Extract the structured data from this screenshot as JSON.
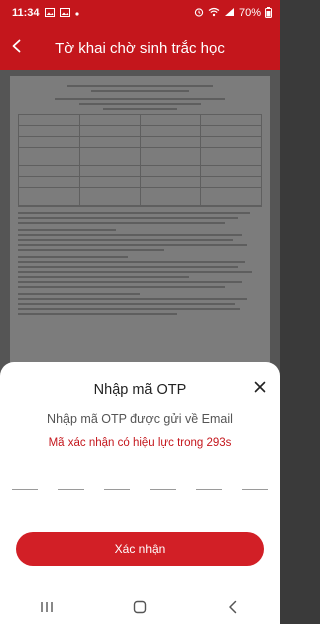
{
  "status_bar": {
    "time": "11:34",
    "battery": "70%",
    "left_icons": [
      "image-icon",
      "image-icon",
      "dot-icon"
    ],
    "right_icons": [
      "alarm-icon",
      "wifi-icon",
      "signal-icon",
      "battery-icon"
    ]
  },
  "header": {
    "title": "Tờ khai chờ sinh trắc học",
    "back_icon": "arrow-left-icon",
    "color": "#c4161c"
  },
  "otp_sheet": {
    "title": "Nhập mã OTP",
    "subtitle": "Nhập mã OTP được gửi về Email",
    "validity_text": "Mã xác nhận có hiệu lực trong 293s",
    "digit_count": 6,
    "digits": [
      "",
      "",
      "",
      "",
      "",
      ""
    ],
    "confirm_label": "Xác nhận",
    "close_icon": "close-icon",
    "accent_color": "#d21f26"
  },
  "nav_bar": {
    "items": [
      "recent-apps-icon",
      "home-icon",
      "back-icon"
    ]
  }
}
